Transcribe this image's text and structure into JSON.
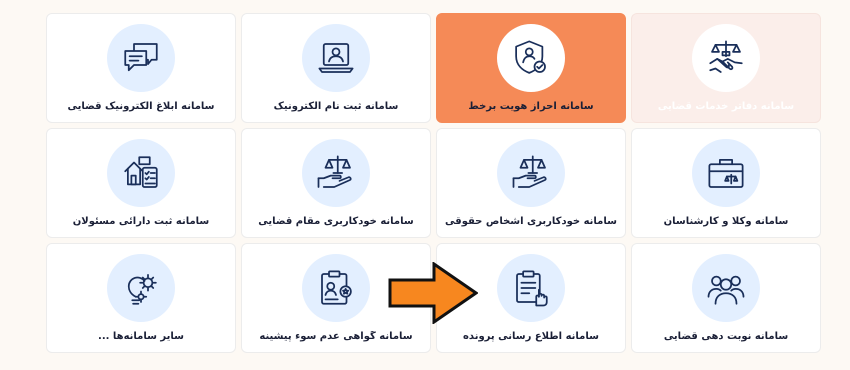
{
  "cards": [
    {
      "label": "سامانه ابلاغ الکترونیک قضایی",
      "icon": "chat-bubbles-icon"
    },
    {
      "label": "سامانه ثبت نام الکترونیک",
      "icon": "laptop-user-icon"
    },
    {
      "label": "سامانه احراز هویت برخط",
      "icon": "shield-user-check-icon"
    },
    {
      "label": "سامانه دفاتر خدمات قضایی",
      "icon": "scales-handshake-icon"
    },
    {
      "label": "سامانه ثبت دارائی مسئولان",
      "icon": "property-checklist-icon"
    },
    {
      "label": "سامانه خودکاربری مقام قضایی",
      "icon": "scales-hand-icon"
    },
    {
      "label": "سامانه خودکاربری اشخاص حقوقی",
      "icon": "scales-hand-icon"
    },
    {
      "label": "سامانه وکلا و کارشناسان",
      "icon": "briefcase-scales-icon"
    },
    {
      "label": "سایر سامانه‌ها ...",
      "icon": "bulb-gears-icon"
    },
    {
      "label": "سامانه گواهی عدم سوء پیشینه",
      "icon": "certificate-clipboard-icon"
    },
    {
      "label": "سامانه اطلاع رسانی پرونده",
      "icon": "clipboard-touch-icon"
    },
    {
      "label": "سامانه نوبت دهی قضایی",
      "icon": "people-queue-icon"
    }
  ],
  "colors": {
    "icon_stroke": "#1a2f5a",
    "circle_bg": "#e3efff",
    "active_card": "#f58a57",
    "faded_card": "#fbeeea",
    "arrow_fill": "#f7871f"
  }
}
